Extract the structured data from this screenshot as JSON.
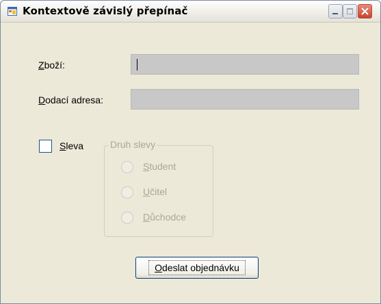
{
  "window": {
    "title": "Kontextově závislý přepínač",
    "buttons": [
      "minimize",
      "maximize",
      "close"
    ]
  },
  "form": {
    "zbozi": {
      "label_hotkey": "Z",
      "label_rest": "boží:",
      "value": ""
    },
    "adresa": {
      "label_hotkey": "D",
      "label_rest": "odací adresa:",
      "value": ""
    },
    "sleva": {
      "label_hotkey": "S",
      "label_rest": "leva",
      "checked": false
    },
    "druh_slevy": {
      "title": "Druh slevy",
      "options": [
        {
          "hotkey": "S",
          "pre": "",
          "rest": "tudent"
        },
        {
          "hotkey": "U",
          "pre": "",
          "rest": "čitel"
        },
        {
          "hotkey": "D",
          "pre": "",
          "rest": "ůchodce"
        }
      ],
      "enabled": false
    },
    "submit": {
      "hotkey": "O",
      "rest": "deslat objednávku"
    }
  },
  "colors": {
    "window_bg": "#ece9d8",
    "field_bg": "#c8c8c8",
    "disabled_text": "#a9a797",
    "close_red": "#c9432b"
  }
}
